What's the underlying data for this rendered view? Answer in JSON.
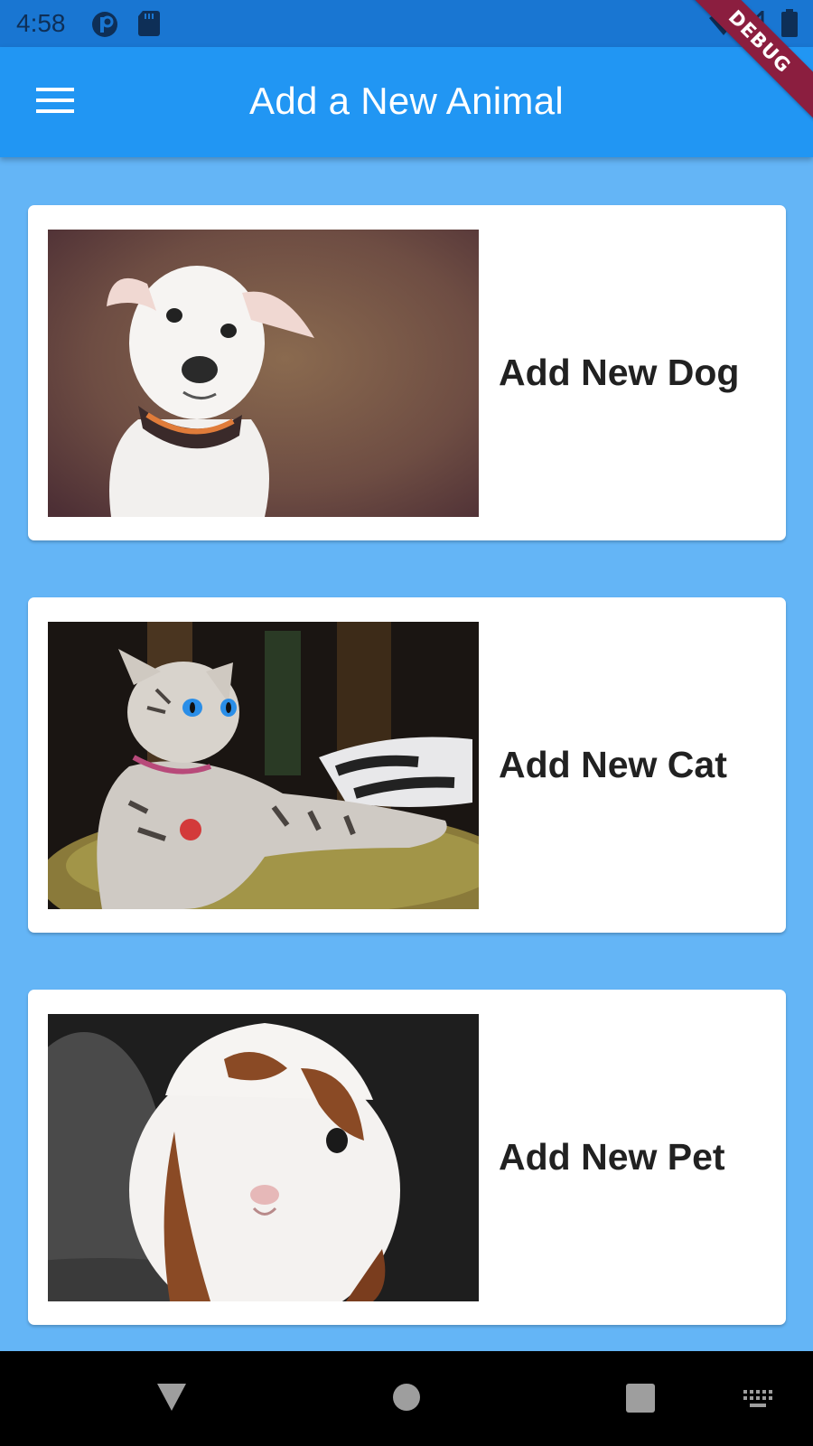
{
  "status_bar": {
    "time": "4:58",
    "icons": [
      "app-notification-icon",
      "sd-card-icon",
      "wifi-icon",
      "signal-icon",
      "battery-icon"
    ]
  },
  "app_bar": {
    "title": "Add a New Animal",
    "menu_icon": "hamburger-menu-icon",
    "color": "#2196f3"
  },
  "debug_banner": {
    "label": "DEBUG",
    "color": "#8b1e3f"
  },
  "cards": [
    {
      "label": "Add New Dog",
      "image": "white-puppy-photo"
    },
    {
      "label": "Add New Cat",
      "image": "tabby-cat-photo"
    },
    {
      "label": "Add New Pet",
      "image": "guinea-pig-photo"
    }
  ],
  "nav_bar": {
    "icons": [
      "back-icon",
      "home-icon",
      "recents-icon",
      "keyboard-icon"
    ]
  },
  "colors": {
    "background": "#64b5f6",
    "status_bar": "#1976d2",
    "card": "#ffffff",
    "label_text": "#212121"
  }
}
